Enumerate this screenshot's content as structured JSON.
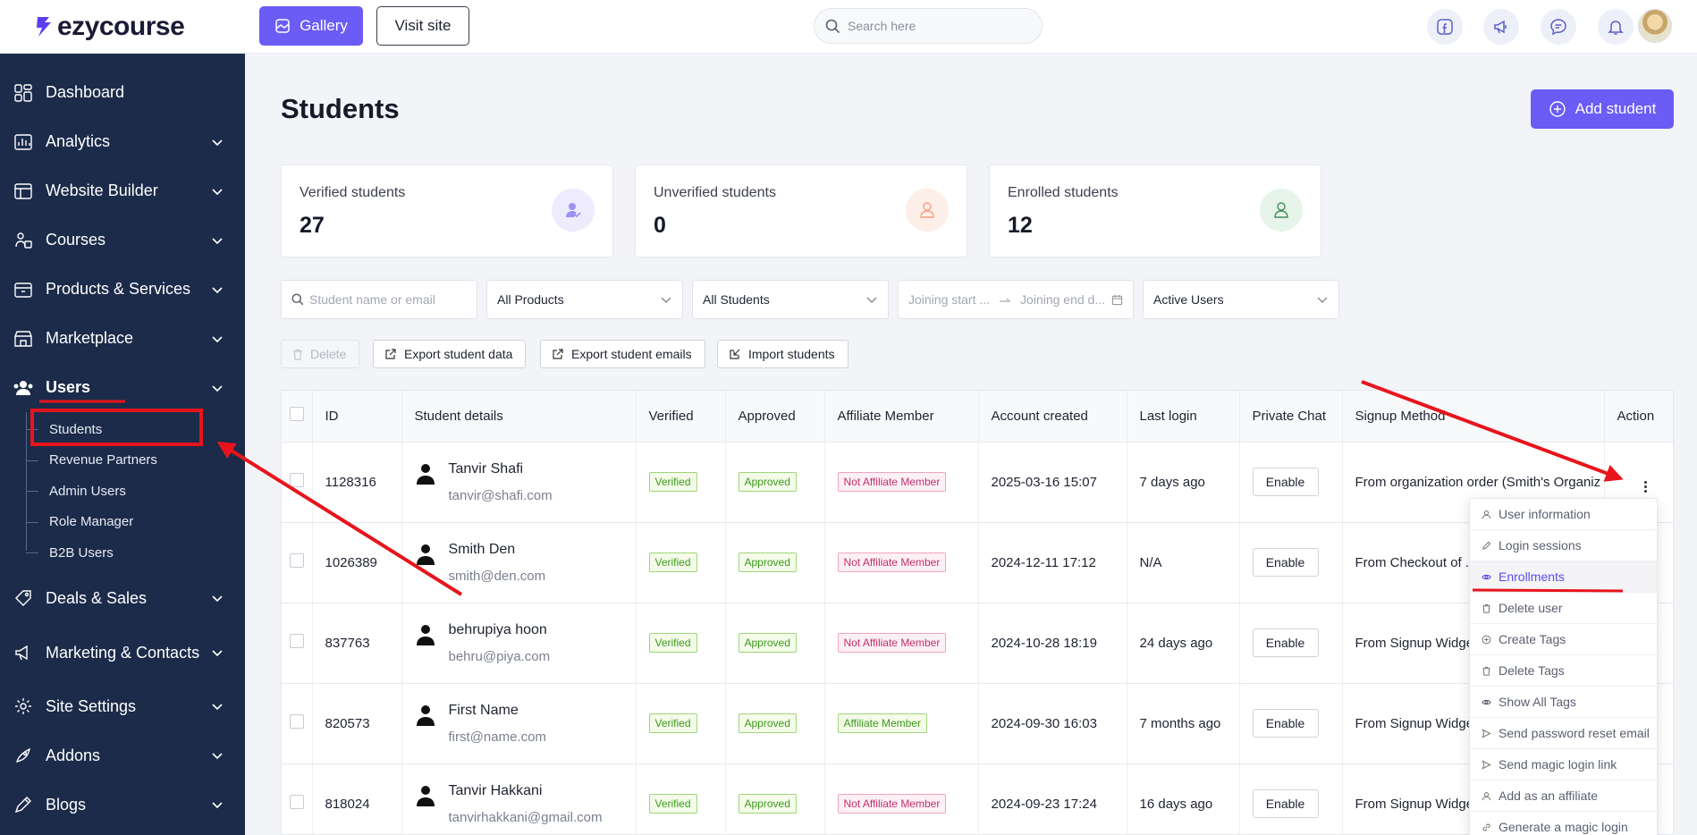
{
  "brand": {
    "name": "ezycourse"
  },
  "topbar": {
    "gallery_label": "Gallery",
    "visit_label": "Visit site",
    "search_placeholder": "Search here"
  },
  "sidebar": {
    "items": [
      {
        "label": "Dashboard",
        "icon": "dashboard-icon"
      },
      {
        "label": "Analytics",
        "icon": "analytics-icon"
      },
      {
        "label": "Website Builder",
        "icon": "website-builder-icon"
      },
      {
        "label": "Courses",
        "icon": "courses-icon"
      },
      {
        "label": "Products & Services",
        "icon": "products-icon"
      },
      {
        "label": "Marketplace",
        "icon": "marketplace-icon"
      },
      {
        "label": "Users",
        "icon": "users-icon"
      },
      {
        "label": "Deals & Sales",
        "icon": "deals-icon"
      },
      {
        "label": "Marketing & Contacts",
        "icon": "marketing-icon"
      },
      {
        "label": "Site Settings",
        "icon": "settings-icon"
      },
      {
        "label": "Addons",
        "icon": "addons-icon"
      },
      {
        "label": "Blogs",
        "icon": "blogs-icon"
      }
    ],
    "users_sub": [
      "Students",
      "Revenue Partners",
      "Admin Users",
      "Role Manager",
      "B2B Users"
    ]
  },
  "page": {
    "title": "Students",
    "add_label": "Add student"
  },
  "stats": [
    {
      "label": "Verified students",
      "value": "27",
      "color": "#8b7cf6"
    },
    {
      "label": "Unverified students",
      "value": "0",
      "color": "#f29a72"
    },
    {
      "label": "Enrolled students",
      "value": "12",
      "color": "#3c8f5a"
    }
  ],
  "filters": {
    "search_placeholder": "Student name or email",
    "product": "All Products",
    "students": "All Students",
    "date_start_placeholder": "Joining start ...",
    "date_end_placeholder": "Joining end d...",
    "status": "Active Users"
  },
  "actions": {
    "delete": "Delete",
    "export_data": "Export student data",
    "export_emails": "Export student emails",
    "import": "Import students"
  },
  "table": {
    "headers": [
      "ID",
      "Student details",
      "Verified",
      "Approved",
      "Affiliate Member",
      "Account created",
      "Last login",
      "Private Chat",
      "Signup Method",
      "Action"
    ],
    "rows": [
      {
        "id": "1128316",
        "name": "Tanvir Shafi",
        "email": "tanvir@shafi.com",
        "verified": "Verified",
        "approved": "Approved",
        "affiliate": "Not Affiliate Member",
        "affiliate_status": "no",
        "created": "2025-03-16 15:07",
        "last_login": "7 days ago",
        "chat": "Enable",
        "signup": "From organization order (Smith's Organiz"
      },
      {
        "id": "1026389",
        "name": "Smith Den",
        "email": "smith@den.com",
        "verified": "Verified",
        "approved": "Approved",
        "affiliate": "Not Affiliate Member",
        "affiliate_status": "no",
        "created": "2024-12-11 17:12",
        "last_login": "N/A",
        "chat": "Enable",
        "signup": "From Checkout of ..."
      },
      {
        "id": "837763",
        "name": "behrupiya hoon",
        "email": "behru@piya.com",
        "verified": "Verified",
        "approved": "Approved",
        "affiliate": "Not Affiliate Member",
        "affiliate_status": "no",
        "created": "2024-10-28 18:19",
        "last_login": "24 days ago",
        "chat": "Enable",
        "signup": "From Signup Widge"
      },
      {
        "id": "820573",
        "name": "First Name",
        "email": "first@name.com",
        "verified": "Verified",
        "approved": "Approved",
        "affiliate": "Affiliate Member",
        "affiliate_status": "yes",
        "created": "2024-09-30 16:03",
        "last_login": "7 months ago",
        "chat": "Enable",
        "signup": "From Signup Widge"
      },
      {
        "id": "818024",
        "name": "Tanvir Hakkani",
        "email": "tanvirhakkani@gmail.com",
        "verified": "Verified",
        "approved": "Approved",
        "affiliate": "Not Affiliate Member",
        "affiliate_status": "no",
        "created": "2024-09-23 17:24",
        "last_login": "16 days ago",
        "chat": "Enable",
        "signup": "From Signup Widge"
      }
    ]
  },
  "action_menu": {
    "items": [
      {
        "label": "User information",
        "icon": "user-icon"
      },
      {
        "label": "Login sessions",
        "icon": "edit-icon"
      },
      {
        "label": "Enrollments",
        "icon": "eye-icon"
      },
      {
        "label": "Delete user",
        "icon": "trash-icon"
      },
      {
        "label": "Create Tags",
        "icon": "plus-circle-icon"
      },
      {
        "label": "Delete Tags",
        "icon": "trash-icon"
      },
      {
        "label": "Show All Tags",
        "icon": "eye-icon"
      },
      {
        "label": "Send password reset email",
        "icon": "send-icon"
      },
      {
        "label": "Send magic login link",
        "icon": "send-icon"
      },
      {
        "label": "Add as an affiliate",
        "icon": "user-icon"
      },
      {
        "label": "Generate a magic login",
        "icon": "link-icon"
      }
    ],
    "highlighted": "Enrollments"
  },
  "colors": {
    "accent": "#6a5cf5",
    "sidebar": "#1c2b4a",
    "annotation": "#e8141c"
  }
}
